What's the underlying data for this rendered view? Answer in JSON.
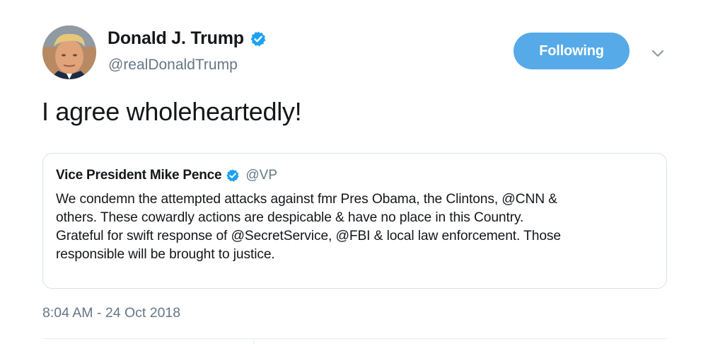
{
  "author": {
    "display_name": "Donald J. Trump",
    "handle": "@realDonaldTrump",
    "verified_icon": "verified-badge-icon",
    "avatar_icon": "profile-photo"
  },
  "follow_button": {
    "label": "Following",
    "color": "#56aae8"
  },
  "menu_icon": "chevron-down-icon",
  "tweet": {
    "text": "I agree wholeheartedly!",
    "timestamp": "8:04 AM - 24 Oct 2018"
  },
  "quoted_tweet": {
    "display_name": "Vice President Mike Pence",
    "handle": "@VP",
    "verified_icon": "verified-badge-icon",
    "lines": [
      "We condemn the attempted attacks against fmr Pres Obama, the Clintons, @CNN &",
      "others. These cowardly actions are despicable & have no place in this Country.",
      "Grateful for swift response of @SecretService, @FBI & local law enforcement. Those",
      "responsible will be brought to justice."
    ]
  },
  "colors": {
    "verified": "#1da1f2",
    "secondary_text": "#657786",
    "border": "#d8e1e8"
  }
}
